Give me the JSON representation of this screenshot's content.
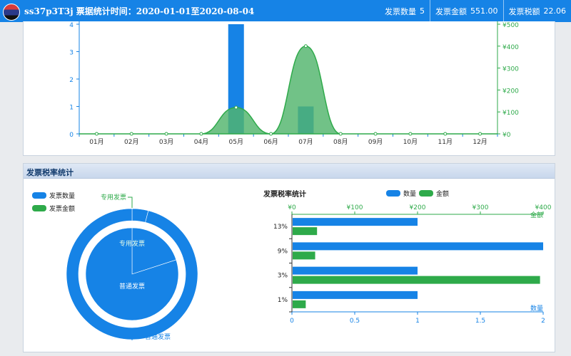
{
  "header": {
    "title": "ss37p3T3j  票据统计时间：2020-01-01至2020-08-04",
    "stats": [
      {
        "label": "发票数量",
        "value": "5"
      },
      {
        "label": "发票金额",
        "value": "551.00"
      },
      {
        "label": "发票税额",
        "value": "22.06"
      }
    ]
  },
  "tax_panel": {
    "title": "发票税率统计"
  },
  "colors": {
    "blue": "#1683e6",
    "green": "#2eaa4a",
    "area": "#52b56d"
  },
  "chart_data": [
    {
      "type": "bar",
      "categories": [
        "01月",
        "02月",
        "03月",
        "04月",
        "05月",
        "06月",
        "07月",
        "08月",
        "09月",
        "10月",
        "11月",
        "12月"
      ],
      "series": [
        {
          "values": [
            0,
            0,
            0,
            0,
            4,
            0,
            1,
            0,
            0,
            0,
            0,
            0
          ]
        },
        {
          "type": "area",
          "values": [
            0,
            0,
            0,
            0,
            120,
            0,
            400,
            0,
            0,
            0,
            0,
            0
          ]
        }
      ],
      "left_ticks": [
        "0",
        "1",
        "2",
        "3",
        "4"
      ],
      "right_ticks": [
        "¥0",
        "¥100",
        "¥200",
        "¥300",
        "¥400",
        "¥500"
      ],
      "ylim": [
        0,
        4
      ],
      "y2lim": [
        0,
        500
      ]
    },
    {
      "type": "pie",
      "legend": [
        "发票数量",
        "发票金额"
      ],
      "inner": {
        "labels": [
          "专用发票",
          "普通发票"
        ],
        "values": [
          1,
          4
        ]
      },
      "outer": {
        "labels": [
          "专用发票",
          "普通发票"
        ],
        "values": [
          22,
          529
        ]
      },
      "callouts": [
        "专用发票",
        "普通发票"
      ]
    },
    {
      "type": "bar",
      "orientation": "horizontal",
      "title": "发票税率统计",
      "legend": [
        "数量",
        "金额"
      ],
      "categories": [
        "1%",
        "3%",
        "9%",
        "13%"
      ],
      "series": [
        {
          "name": "数量",
          "values": [
            1,
            1,
            2,
            1
          ]
        },
        {
          "name": "金额",
          "values": [
            22,
            395,
            37,
            40
          ]
        }
      ],
      "x_ticks": [
        "0",
        "0.5",
        "1",
        "1.5",
        "2"
      ],
      "x_label": "数量",
      "x2_ticks": [
        "¥0",
        "¥100",
        "¥200",
        "¥300",
        "¥400"
      ],
      "x2_label": "金额",
      "xlim": [
        0,
        2
      ],
      "x2lim": [
        0,
        400
      ]
    }
  ]
}
